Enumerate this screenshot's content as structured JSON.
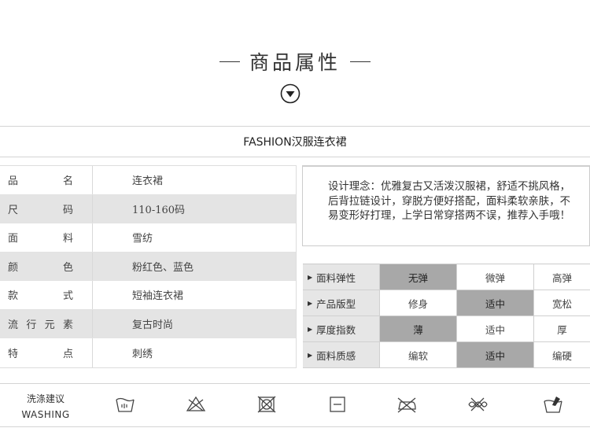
{
  "header": {
    "title": "商品属性",
    "section_title": "FASHION汉服连衣裙"
  },
  "spec_table": [
    {
      "key": [
        "品",
        "名"
      ],
      "value": "连衣裙",
      "shaded": false
    },
    {
      "key": [
        "尺",
        "码"
      ],
      "value": "110-160码",
      "shaded": true
    },
    {
      "key": [
        "面",
        "料"
      ],
      "value": "雪纺",
      "shaded": false
    },
    {
      "key": [
        "颜",
        "色"
      ],
      "value": "粉红色、蓝色",
      "shaded": true
    },
    {
      "key": [
        "款",
        "式"
      ],
      "value": "短袖连衣裙",
      "shaded": false
    },
    {
      "key": [
        "流",
        "行",
        "元",
        "素"
      ],
      "value": "复古时尚",
      "shaded": true
    },
    {
      "key": [
        "特",
        "点"
      ],
      "value": "刺绣",
      "shaded": false
    }
  ],
  "description": "设计理念：优雅复古又活泼汉服裙，舒适不挑风格，后背拉链设计，穿脱方便好搭配，面料柔软亲肤，不易变形好打理，上学日常穿搭两不误，推荐入手哦！",
  "attributes": [
    {
      "label": "面料弹性",
      "options": [
        "无弹",
        "微弹",
        "高弹"
      ],
      "selected": 0
    },
    {
      "label": "产品版型",
      "options": [
        "修身",
        "适中",
        "宽松"
      ],
      "selected": 1
    },
    {
      "label": "厚度指数",
      "options": [
        "薄",
        "适中",
        "厚"
      ],
      "selected": 0
    },
    {
      "label": "面料质感",
      "options": [
        "编软",
        "适中",
        "编硬"
      ],
      "selected": 1
    }
  ],
  "washing": {
    "label_cn": "洗涤建议",
    "label_en": "WASHING",
    "icons": [
      "hand-wash-icon",
      "do-not-bleach-icon",
      "do-not-tumble-dry-icon",
      "dry-flat-icon",
      "do-not-iron-icon",
      "do-not-wring-icon",
      "hand-wash-basin-icon"
    ]
  },
  "colors": {
    "shaded_row": "#e4e4e4",
    "selected_option": "#a8a8a8",
    "label_cell": "#e6e6e6"
  }
}
